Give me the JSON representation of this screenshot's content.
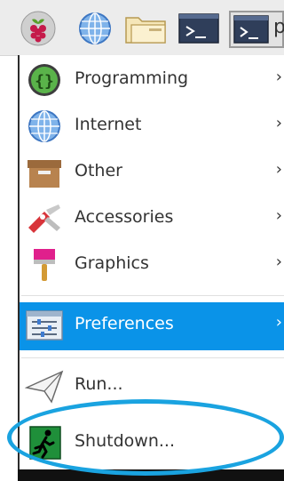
{
  "menu": {
    "items": [
      {
        "label": "Programming",
        "arrow": "›"
      },
      {
        "label": "Internet",
        "arrow": "›"
      },
      {
        "label": "Other",
        "arrow": "›"
      },
      {
        "label": "Accessories",
        "arrow": "›"
      },
      {
        "label": "Graphics",
        "arrow": "›"
      },
      {
        "label": "Preferences",
        "arrow": "›"
      },
      {
        "label": "Run..."
      },
      {
        "label": "Shutdown..."
      }
    ]
  },
  "taskbar": {
    "trailing_text": "p"
  },
  "colors": {
    "selected_bg": "#0a93e8",
    "highlight_circle": "#1aa3e0"
  }
}
